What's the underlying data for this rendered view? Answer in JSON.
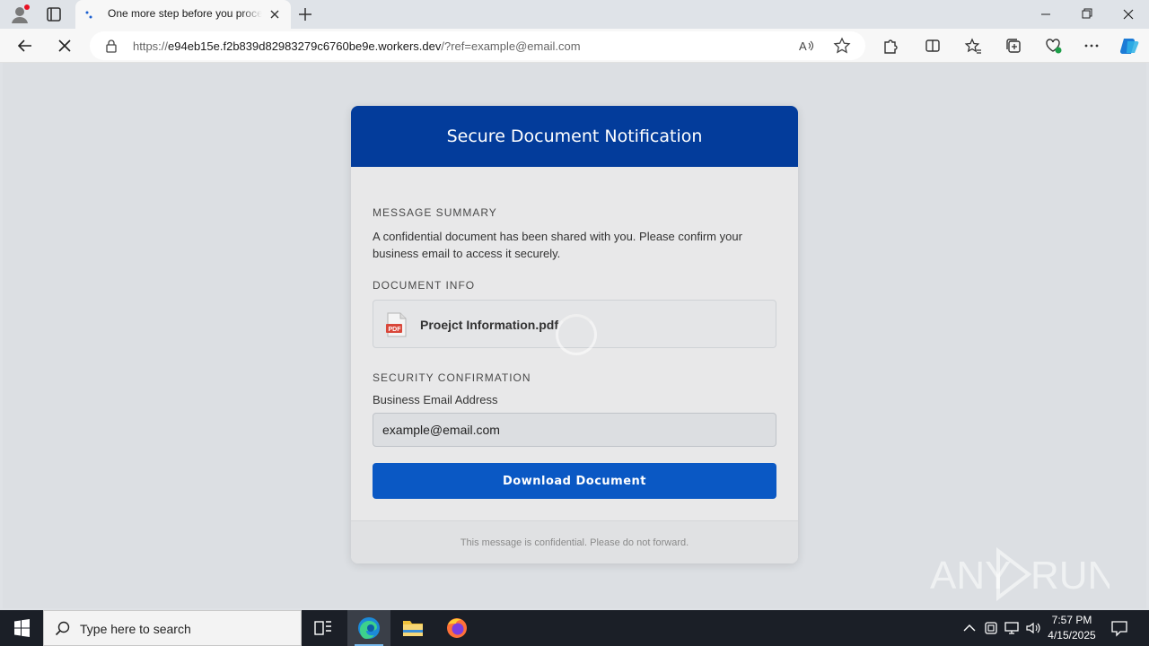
{
  "browser": {
    "tab_title": "One more step before you proceed",
    "url_prefix": "https://",
    "url_host": "e94eb15e.f2b839d82983279c6760be9e.workers.dev",
    "url_path": "/?ref=example@email.com"
  },
  "page": {
    "title": "Secure Document Notification",
    "summary_label": "MESSAGE SUMMARY",
    "summary_text": "A confidential document has been shared with you. Please confirm your business email to access it securely.",
    "doc_label": "DOCUMENT INFO",
    "doc_name": "Proejct Information.pdf",
    "doc_icon_text": "PDF",
    "security_label": "SECURITY CONFIRMATION",
    "email_label": "Business Email Address",
    "email_value": "example@email.com",
    "download_label": "Download Document",
    "footer_text": "This message is confidential. Please do not forward.",
    "header_color": "#033c9b",
    "button_color": "#0a58c4"
  },
  "watermark": {
    "text_left": "ANY",
    "text_right": "RUN"
  },
  "taskbar": {
    "search_placeholder": "Type here to search",
    "time": "7:57 PM",
    "date": "4/15/2025"
  }
}
